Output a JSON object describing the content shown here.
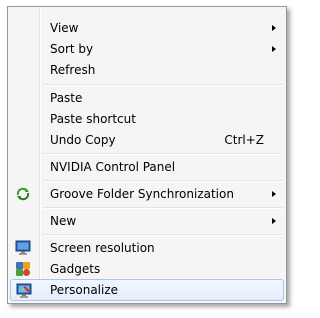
{
  "menu": {
    "items": [
      {
        "label": "View"
      },
      {
        "label": "Sort by"
      },
      {
        "label": "Refresh"
      },
      {
        "label": "Paste"
      },
      {
        "label": "Paste shortcut"
      },
      {
        "label": "Undo Copy",
        "shortcut": "Ctrl+Z"
      },
      {
        "label": "NVIDIA Control Panel"
      },
      {
        "label": "Groove Folder Synchronization",
        "icon": "groove-sync-icon"
      },
      {
        "label": "New"
      },
      {
        "label": "Screen resolution",
        "icon": "monitor-icon"
      },
      {
        "label": "Gadgets",
        "icon": "gadgets-icon"
      },
      {
        "label": "Personalize",
        "icon": "personalize-icon"
      }
    ]
  },
  "colors": {
    "menu_background": "#f5f5f5",
    "menu_border": "#979797",
    "highlight_border": "#a8c7ef",
    "groove_icon": "#3a9a2a"
  }
}
